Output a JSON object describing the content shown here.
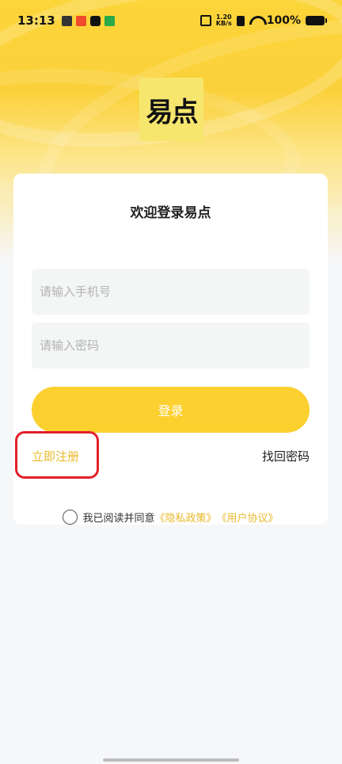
{
  "status_bar": {
    "time": "13:13",
    "net_speed_value": "1.20",
    "net_speed_unit": "KB/s",
    "battery": "100%"
  },
  "logo": {
    "text": "易点"
  },
  "login": {
    "title": "欢迎登录易点",
    "phone_placeholder": "请输入手机号",
    "password_placeholder": "请输入密码",
    "login_button": "登录",
    "register_link": "立即注册",
    "forgot_link": "找回密码",
    "agreement_text": "我已阅读并同意",
    "privacy_policy": "《隐私政策》",
    "user_agreement": "《用户协议》"
  },
  "colors": {
    "accent": "#fcd02f",
    "link": "#e9b92a",
    "highlight_box": "#e0202b"
  }
}
